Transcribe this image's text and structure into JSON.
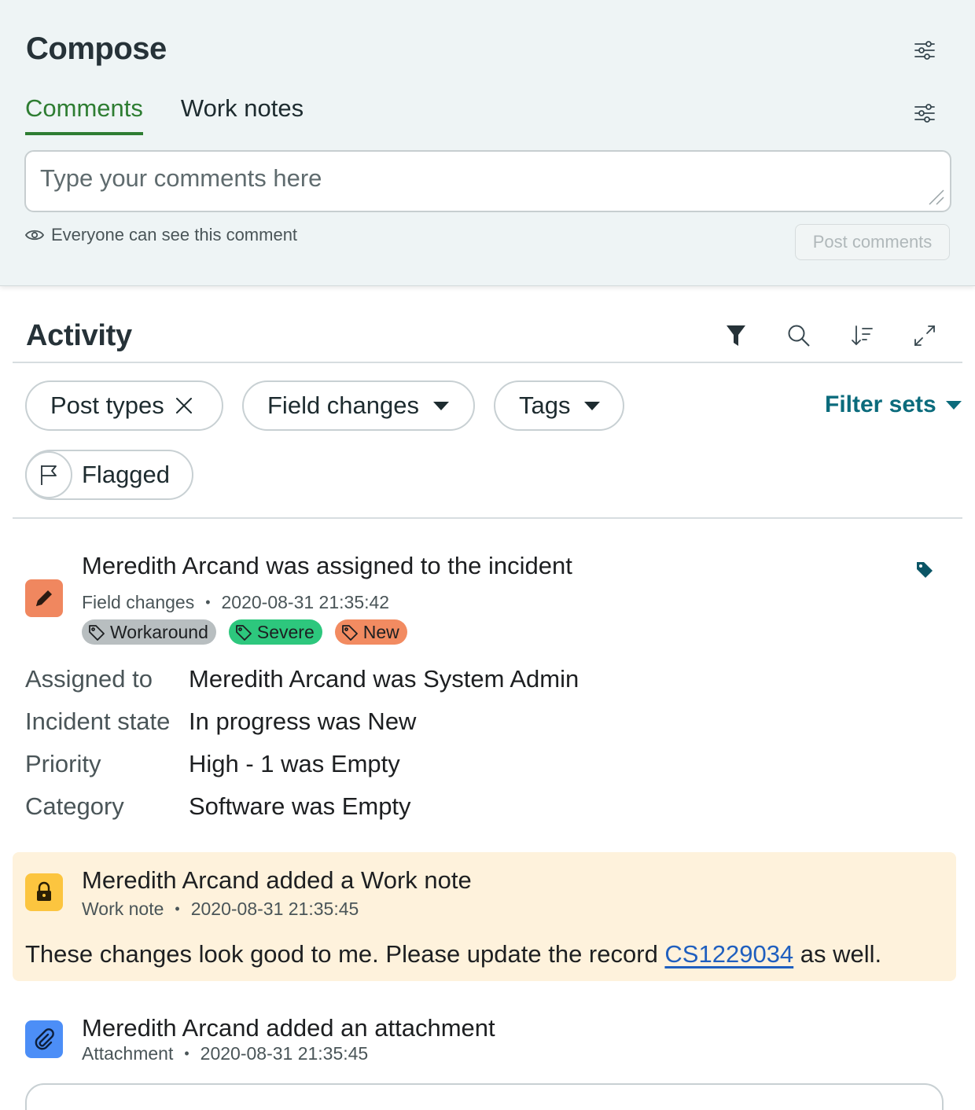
{
  "compose": {
    "title": "Compose",
    "tabs": [
      {
        "label": "Comments",
        "active": true
      },
      {
        "label": "Work notes",
        "active": false
      }
    ],
    "placeholder": "Type your comments here",
    "visibility_text": "Everyone can see this comment",
    "post_button": "Post comments",
    "icons": [
      "tune-icon",
      "tune-icon"
    ]
  },
  "activity": {
    "title": "Activity",
    "toolbar_icons": [
      "filter-icon",
      "search-icon",
      "sort-icon",
      "expand-icon"
    ],
    "chips": [
      {
        "label": "Post types",
        "icon": "close-icon"
      },
      {
        "label": "Field changes",
        "icon": "caret-down-icon"
      },
      {
        "label": "Tags",
        "icon": "caret-down-icon"
      }
    ],
    "filter_sets": "Filter sets",
    "flagged": "Flagged"
  },
  "entries": [
    {
      "title": "Meredith Arcand was assigned to the incident",
      "type": "Field changes",
      "timestamp": "2020-08-31 21:35:42",
      "badge_color": "#f0875f",
      "tags": [
        {
          "label": "Workaround",
          "color": "#b8bec0"
        },
        {
          "label": "Severe",
          "color": "#2dc77d"
        },
        {
          "label": "New",
          "color": "#f28b61"
        }
      ],
      "fields": [
        {
          "name": "Assigned to",
          "value": "Meredith Arcand was System Admin"
        },
        {
          "name": "Incident state",
          "value": "In progress was New"
        },
        {
          "name": "Priority",
          "value": "High - 1 was Empty"
        },
        {
          "name": "Category",
          "value": "Software was Empty"
        }
      ]
    },
    {
      "title": "Meredith Arcand added a Work note",
      "type": "Work note",
      "timestamp": "2020-08-31 21:35:45",
      "badge_color": "#fcc53f",
      "body_before": "These changes look good to me. Please update the record ",
      "body_link": "CS1229034",
      "body_after": " as well."
    },
    {
      "title": "Meredith Arcand added an attachment",
      "type": "Attachment",
      "timestamp": "2020-08-31 21:35:45",
      "badge_color": "#4c8ef7"
    }
  ]
}
